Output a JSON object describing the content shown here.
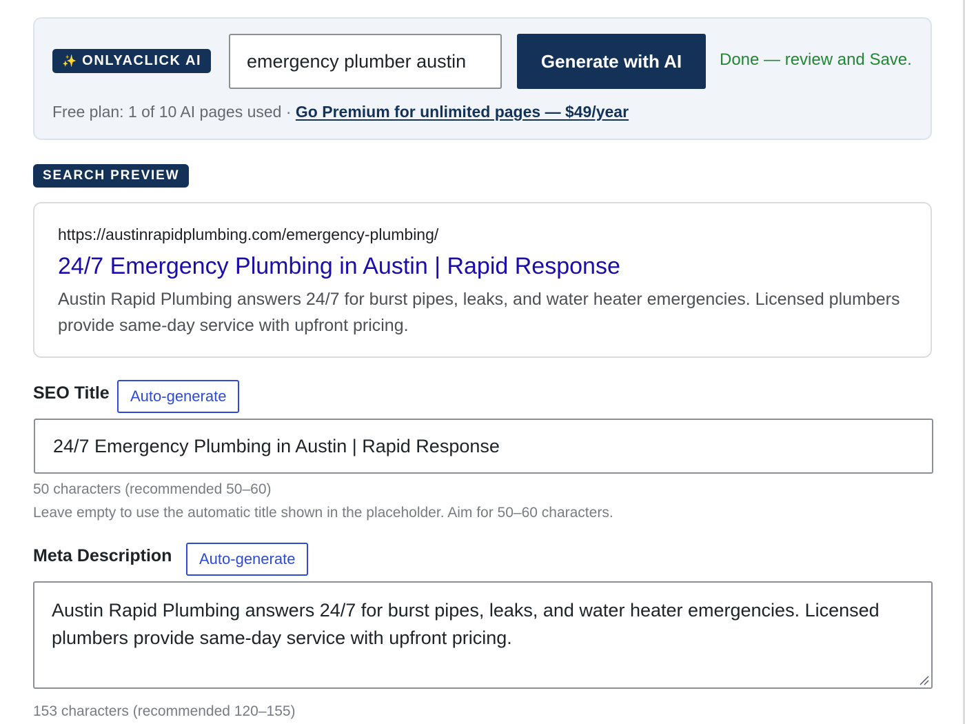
{
  "ai_panel": {
    "badge_icon": "sparkles-icon",
    "badge_label": "ONLYACLICK AI",
    "keyword_value": "emergency plumber austin",
    "generate_label": "Generate with AI",
    "status_text": "Done — review and Save.",
    "plan_text": "Free plan: 1 of 10 AI pages used · ",
    "premium_link": "Go Premium for unlimited pages — $49/year"
  },
  "preview": {
    "label": "SEARCH PREVIEW",
    "url": "https://austinrapidplumbing.com/emergency-plumbing/",
    "title": "24/7 Emergency Plumbing in Austin | Rapid Response",
    "description": "Austin Rapid Plumbing answers 24/7 for burst pipes, leaks, and water heater emergencies. Licensed plumbers provide same-day service with upfront pricing."
  },
  "seo_title": {
    "label": "SEO Title",
    "auto_label": "Auto-generate",
    "value": "24/7 Emergency Plumbing in Austin | Rapid Response",
    "count_text": "50 characters (recommended 50–60)",
    "help_text": "Leave empty to use the automatic title shown in the placeholder. Aim for 50–60 characters."
  },
  "meta_description": {
    "label": "Meta Description",
    "auto_label": "Auto-generate",
    "value": "Austin Rapid Plumbing answers 24/7 for burst pipes, leaks, and water heater emergencies. Licensed plumbers provide same-day service with upfront pricing.",
    "count_text": "153 characters (recommended 120–155)"
  },
  "colors": {
    "brand_navy": "#143258",
    "success_green": "#238636",
    "serp_link_blue": "#1a0dab",
    "button_blue": "#2c4bd8"
  }
}
